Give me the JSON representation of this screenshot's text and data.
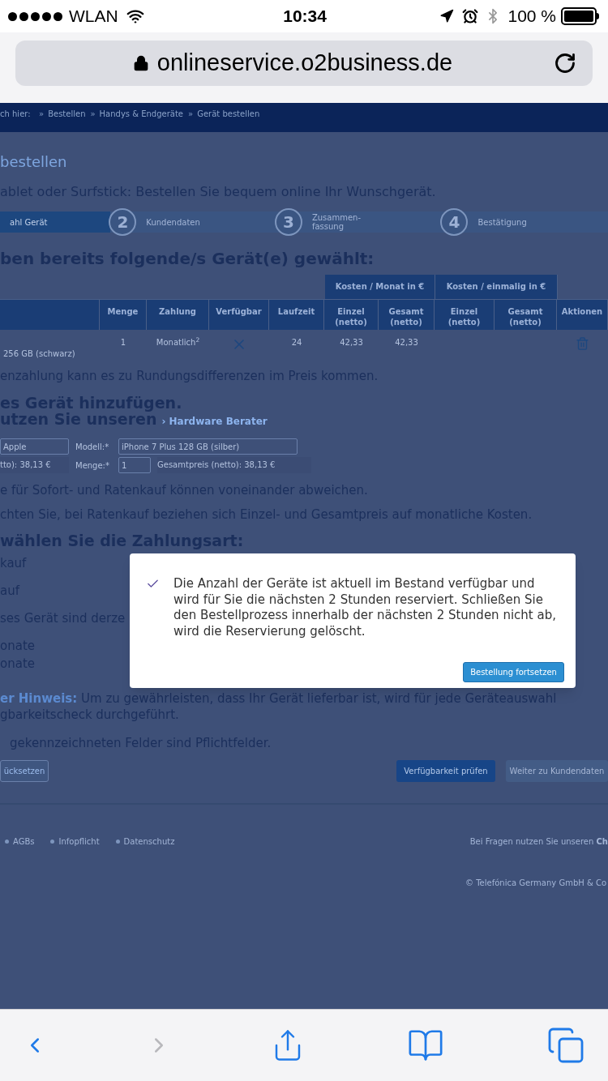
{
  "status_bar": {
    "carrier": "WLAN",
    "time": "10:34",
    "battery": "100 %"
  },
  "address_bar": {
    "url": "onlineservice.o2business.de"
  },
  "breadcrumb": {
    "prefix": "ch hier:",
    "separator": "»",
    "items": [
      "Bestellen",
      "Handys & Endgeräte",
      "Gerät bestellen"
    ]
  },
  "page_title": "bestellen",
  "intro": "ablet oder Surfstick: Bestellen Sie bequem online Ihr Wunschgerät.",
  "steps": [
    {
      "label": "ahl Gerät",
      "selected": true
    },
    {
      "number": "2",
      "label": "Kundendaten",
      "selected": false
    },
    {
      "number": "3",
      "label": "Zusammen-fassung",
      "selected": false
    },
    {
      "number": "4",
      "label": "Bestätigung",
      "selected": false
    }
  ],
  "selected_heading": "ben bereits folgende/s Gerät(e) gewählt:",
  "table": {
    "groups": [
      "Kosten / Monat in €",
      "Kosten / einmalig in €"
    ],
    "columns": [
      "Menge",
      "Zahlung",
      "Verfügbar",
      "Laufzeit",
      "Einzel (netto)",
      "Gesamt (netto)",
      "Einzel (netto)",
      "Gesamt (netto)",
      "Aktionen"
    ],
    "rows": [
      {
        "device": "256 GB (schwarz)",
        "menge": "1",
        "zahlung": "Monatlich$^{2}$",
        "available": false,
        "laufzeit": "24",
        "monat_einzel": "42,33",
        "monat_gesamt": "42,33"
      }
    ]
  },
  "rounding_note": "enzahlung kann es zu Rundungsdifferenzen im Preis kommen.",
  "add_heading": "es Gerät hinzufügen.",
  "advisor_text": "utzen Sie unseren",
  "advisor_link": "› Hardware Berater",
  "form": {
    "hersteller": "Apple",
    "modell_label": "Modell:*",
    "modell": "iPhone 7 Plus 128 GB (silber)",
    "einzelpreis": "tto): 38,13 €",
    "menge_label": "Menge:*",
    "menge": "1",
    "gesamtpreis": "Gesamtpreis (netto): 38,13 €"
  },
  "notes": [
    "e für Sofort- und Ratenkauf können voneinander abweichen.",
    "chten Sie, bei Ratenkauf beziehen sich Einzel- und Gesamtpreis auf monatliche Kosten."
  ],
  "payment_heading": "wählen Sie die Zahlungsart:",
  "payment_lines": [
    "kauf",
    "auf",
    "ses Gerät sind derze",
    "onate",
    "onate"
  ],
  "hint": {
    "label": "er Hinweis:",
    "text": "Um zu gewährleisten, dass Ihr Gerät lieferbar ist, wird für jede Geräteauswahl",
    "continuation": "gbarkeitscheck durchgeführt."
  },
  "required_note": "gekennzeichneten Felder sind Pflichtfelder.",
  "buttons": [
    {
      "label": "ücksetzen",
      "kind": "outline"
    },
    {
      "label": "Verfügbarkeit prüfen",
      "kind": "primary"
    },
    {
      "label": "Weiter zu Kundendaten",
      "kind": "disabled"
    }
  ],
  "footer": {
    "links": [
      "AGBs",
      "Infopflicht",
      "Datenschutz"
    ],
    "contact": "Bei Fragen nutzen Sie unseren **Ch**",
    "copyright": "© Telefónica Germany GmbH & Co"
  },
  "modal": {
    "message": "Die Anzahl der Geräte ist aktuell im Bestand verfügbar und wird für Sie die nächsten 2 Stunden reserviert. Schließen Sie den Bestellprozess innerhalb der nächsten 2 Stunden nicht ab, wird die Reservierung gelöscht.",
    "button": "Bestellung fortsetzen"
  }
}
